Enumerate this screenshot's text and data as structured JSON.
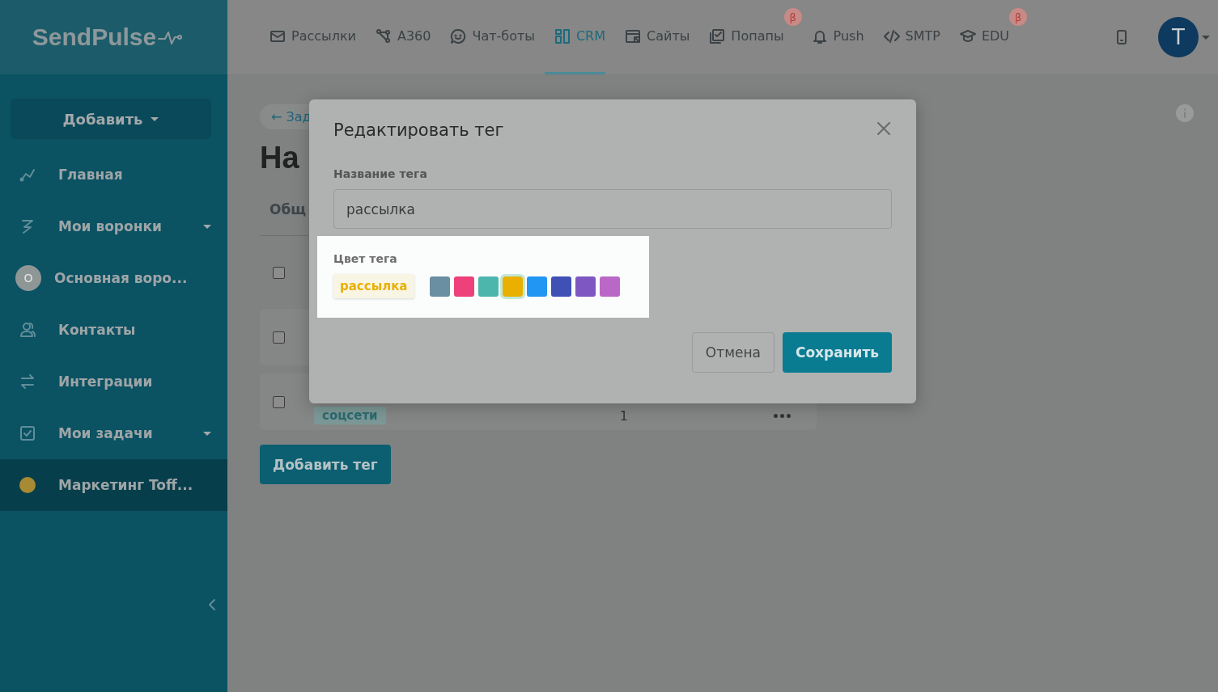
{
  "logo": {
    "text": "SendPulse"
  },
  "nav": [
    {
      "label": "Рассылки",
      "selected": false
    },
    {
      "label": "A360",
      "selected": false
    },
    {
      "label": "Чат-боты",
      "selected": false
    },
    {
      "label": "CRM",
      "selected": true
    },
    {
      "label": "Сайты",
      "selected": false
    },
    {
      "label": "Попапы",
      "selected": false,
      "badge": "β"
    },
    {
      "label": "Push",
      "selected": false
    },
    {
      "label": "SMTP",
      "selected": false
    },
    {
      "label": "EDU",
      "selected": false,
      "badge": "β"
    }
  ],
  "user": {
    "initial": "T"
  },
  "sidebar": {
    "add_button": "Добавить",
    "items": [
      {
        "kind": "link",
        "label": "Главная",
        "selected": false
      },
      {
        "kind": "group",
        "label": "Мои воронки",
        "selected": false
      },
      {
        "kind": "funnel",
        "label": "Основная воро...",
        "initial": "О",
        "selected": false
      },
      {
        "kind": "link",
        "label": "Контакты",
        "selected": false
      },
      {
        "kind": "link",
        "label": "Интеграции",
        "selected": false
      },
      {
        "kind": "group",
        "label": "Мои задачи",
        "selected": false
      },
      {
        "kind": "project",
        "label": "Маркетинг Toff...",
        "color": "#a88a34",
        "selected": true
      }
    ]
  },
  "page": {
    "back_link": "← Зад",
    "heading": "На",
    "tab": "Общ",
    "rows": [
      {
        "checked": false
      },
      {
        "checked": false
      },
      {
        "checked": false,
        "tag": "соцсети",
        "count": "1"
      }
    ],
    "add_tag_button": "Добавить тег"
  },
  "modal": {
    "title": "Редактировать тег",
    "name_label": "Название тега",
    "name_value": "рассылка",
    "color_label": "Цвет тега",
    "preview": "рассылка",
    "swatches": [
      {
        "color": "#6a8fa2",
        "selected": false
      },
      {
        "color": "#ee4079",
        "selected": false
      },
      {
        "color": "#4db6ac",
        "selected": false
      },
      {
        "color": "#e9b000",
        "selected": true
      },
      {
        "color": "#2196f3",
        "selected": false
      },
      {
        "color": "#3f51b5",
        "selected": false
      },
      {
        "color": "#7e57c2",
        "selected": false
      },
      {
        "color": "#ba68c8",
        "selected": false
      }
    ],
    "cancel_button": "Отмена",
    "save_button": "Сохранить"
  }
}
